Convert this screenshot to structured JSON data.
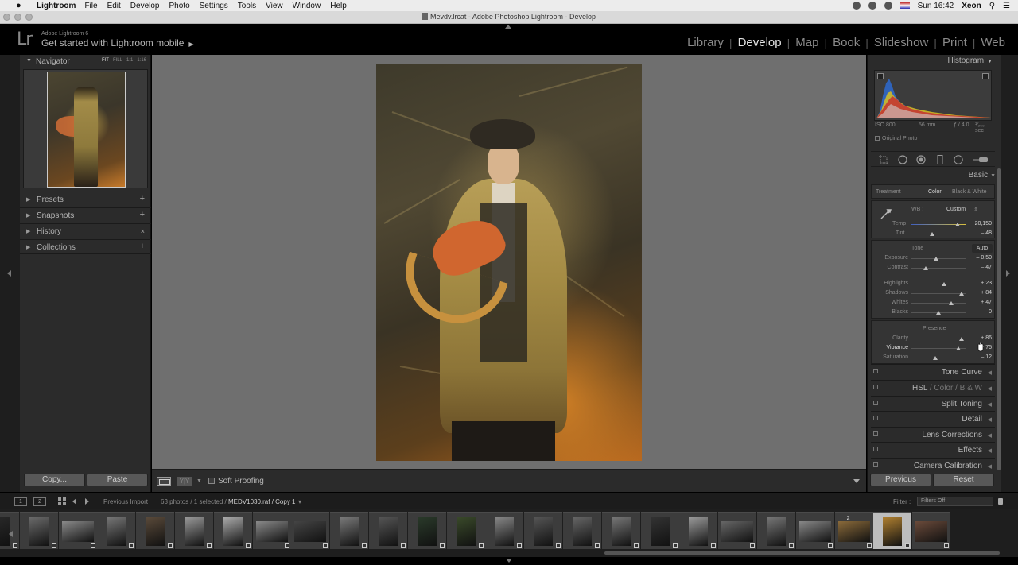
{
  "menubar": {
    "app": "Lightroom",
    "items": [
      "File",
      "Edit",
      "Develop",
      "Photo",
      "Settings",
      "Tools",
      "View",
      "Window",
      "Help"
    ],
    "clock": "Sun 16:42",
    "user": "Xeon"
  },
  "window": {
    "title": "Mevdv.lrcat - Adobe Photoshop Lightroom - Develop"
  },
  "identity": {
    "logo": "Lr",
    "product": "Adobe Lightroom 6",
    "mobile_prompt": "Get started with Lightroom mobile"
  },
  "modules": {
    "items": [
      "Library",
      "Develop",
      "Map",
      "Book",
      "Slideshow",
      "Print",
      "Web"
    ],
    "active": "Develop"
  },
  "left_panel": {
    "navigator": {
      "title": "Navigator",
      "zoom_fit": "FIT",
      "zoom_fill": "FILL",
      "zoom_1": "1:1",
      "zoom_16": "1:16"
    },
    "sections": [
      {
        "label": "Presets",
        "action": "+"
      },
      {
        "label": "Snapshots",
        "action": "+"
      },
      {
        "label": "History",
        "action": "×"
      },
      {
        "label": "Collections",
        "action": "+"
      }
    ],
    "copy_label": "Copy...",
    "paste_label": "Paste"
  },
  "toolbar": {
    "soft_proofing": "Soft Proofing",
    "yy_label": "Y|Y"
  },
  "right_panel": {
    "histogram": {
      "title": "Histogram",
      "iso": "ISO 800",
      "focal": "56 mm",
      "aperture": "ƒ / 4.0",
      "shutter": "¹⁄₂₅₀ sec",
      "original_photo": "Original Photo"
    },
    "basic": {
      "title": "Basic",
      "treatment_label": "Treatment :",
      "treatment_color": "Color",
      "treatment_bw": "Black & White",
      "wb_label": "WB :",
      "wb_value": "Custom",
      "temp": {
        "label": "Temp",
        "value": "20,150",
        "pos": 0.86
      },
      "tint": {
        "label": "Tint",
        "value": "– 48",
        "pos": 0.38
      },
      "tone_label": "Tone",
      "auto_label": "Auto",
      "tone_sliders": [
        {
          "label": "Exposure",
          "value": "– 0.50",
          "pos": 0.46
        },
        {
          "label": "Contrast",
          "value": "– 47",
          "pos": 0.27
        },
        {
          "label": "Highlights",
          "value": "+ 23",
          "pos": 0.61
        },
        {
          "label": "Shadows",
          "value": "+ 84",
          "pos": 0.92
        },
        {
          "label": "Whites",
          "value": "+ 47",
          "pos": 0.73
        },
        {
          "label": "Blacks",
          "value": "0",
          "pos": 0.5
        }
      ],
      "presence_label": "Presence",
      "presence_sliders": [
        {
          "label": "Clarity",
          "value": "+ 86",
          "pos": 0.93
        },
        {
          "label": "Vibrance",
          "value": "+ 75",
          "pos": 0.87
        },
        {
          "label": "Saturation",
          "value": "– 12",
          "pos": 0.44
        }
      ]
    },
    "sections": [
      "Tone Curve",
      "HSL",
      "Split Toning",
      "Detail",
      "Lens Corrections",
      "Effects",
      "Camera Calibration"
    ],
    "hsl_color": "Color",
    "hsl_bw": "B & W",
    "previous_label": "Previous",
    "reset_label": "Reset"
  },
  "filmstrip": {
    "page1": "1",
    "page2": "2",
    "source": "Previous Import",
    "info_prefix": "63 photos / 1 selected /",
    "filename": "MEDV1030.raf / Copy 1",
    "filter_label": "Filter :",
    "filter_value": "Filters Off",
    "stack_badge": "2"
  },
  "colors": {
    "panel": "#2b2b2b",
    "active_module": "#e3e3e3",
    "canvas": "#6f6f6f"
  }
}
